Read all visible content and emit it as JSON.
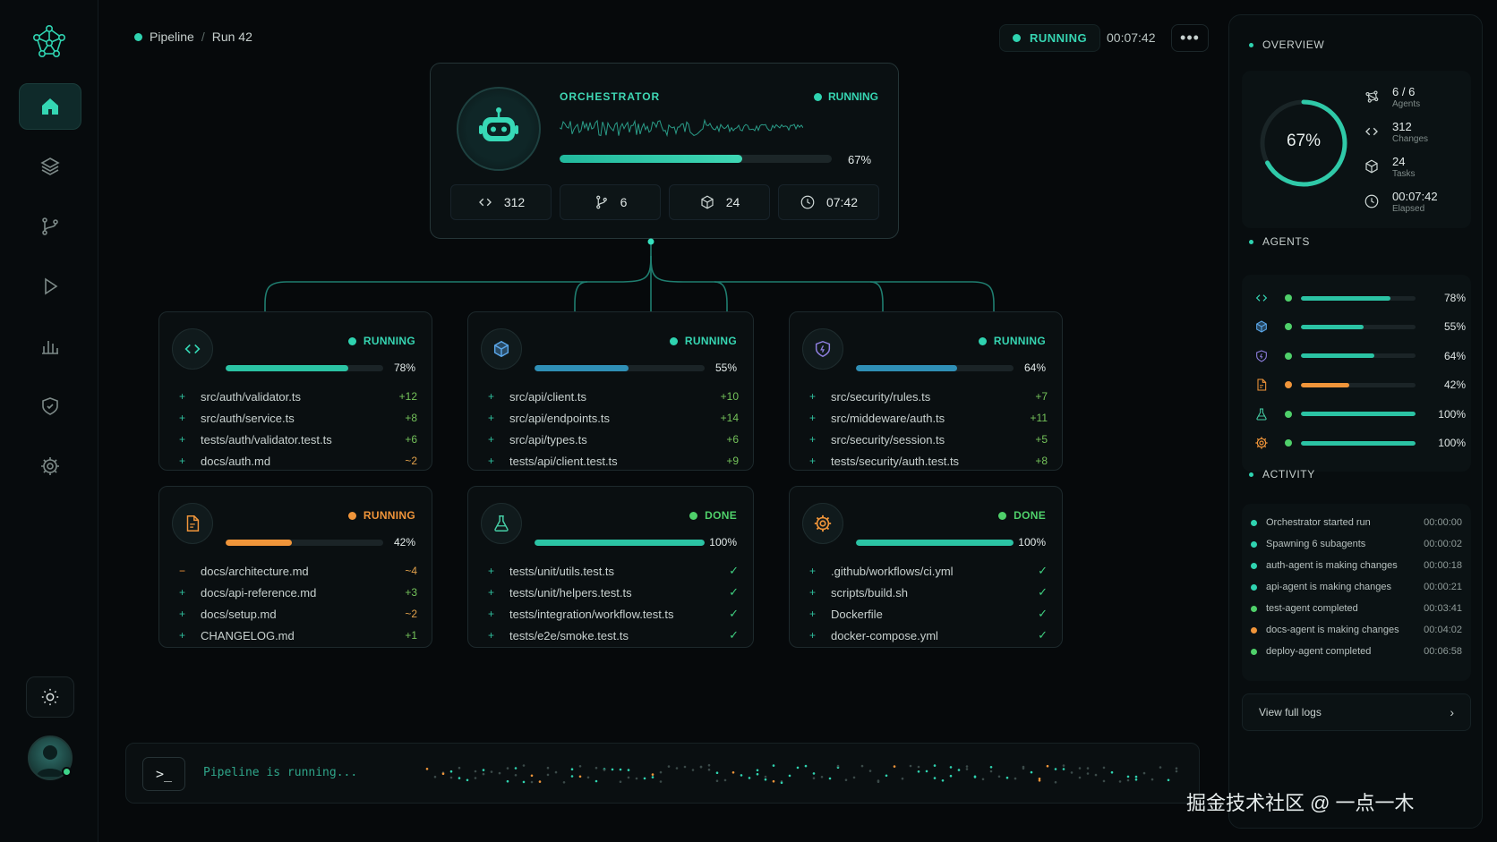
{
  "breadcrumb": {
    "pipeline": "Pipeline",
    "separator": "/",
    "run": "Run 42"
  },
  "top": {
    "status": "RUNNING",
    "elapsed": "00:07:42",
    "more": "•••"
  },
  "orchestrator": {
    "title": "ORCHESTRATOR",
    "status": "RUNNING",
    "progress_pct": 67,
    "progress_label": "67%",
    "stats": {
      "changes": "312",
      "branches": "6",
      "tasks": "24",
      "time": "07:42"
    }
  },
  "cards": [
    {
      "icon": "code-icon",
      "status": "RUNNING",
      "tone": "running",
      "progress_pct": 78,
      "pct_label": "78%",
      "bar_color": "#2bc3a4",
      "files": [
        {
          "mark": "+",
          "name": "src/auth/validator.ts",
          "delta": "+12"
        },
        {
          "mark": "+",
          "name": "src/auth/service.ts",
          "delta": "+8"
        },
        {
          "mark": "+",
          "name": "tests/auth/validator.test.ts",
          "delta": "+6"
        },
        {
          "mark": "+",
          "name": "docs/auth.md",
          "delta": "~2"
        }
      ]
    },
    {
      "icon": "cube-icon",
      "status": "RUNNING",
      "tone": "running",
      "progress_pct": 55,
      "pct_label": "55%",
      "bar_color": "#2f8fb6",
      "files": [
        {
          "mark": "+",
          "name": "src/api/client.ts",
          "delta": "+10"
        },
        {
          "mark": "+",
          "name": "src/api/endpoints.ts",
          "delta": "+14"
        },
        {
          "mark": "+",
          "name": "src/api/types.ts",
          "delta": "+6"
        },
        {
          "mark": "+",
          "name": "tests/api/client.test.ts",
          "delta": "+9"
        }
      ]
    },
    {
      "icon": "shield-icon",
      "status": "RUNNING",
      "tone": "running",
      "progress_pct": 64,
      "pct_label": "64%",
      "bar_color": "#2f8fb6",
      "files": [
        {
          "mark": "+",
          "name": "src/security/rules.ts",
          "delta": "+7"
        },
        {
          "mark": "+",
          "name": "src/middeware/auth.ts",
          "delta": "+11"
        },
        {
          "mark": "+",
          "name": "src/security/session.ts",
          "delta": "+5"
        },
        {
          "mark": "+",
          "name": "tests/security/auth.test.ts",
          "delta": "+8"
        }
      ]
    },
    {
      "icon": "document-icon",
      "status": "RUNNING",
      "tone": "orange",
      "progress_pct": 42,
      "pct_label": "42%",
      "bar_color": "#f0953a",
      "files": [
        {
          "mark": "−",
          "name": "docs/architecture.md",
          "delta": "~4"
        },
        {
          "mark": "+",
          "name": "docs/api-reference.md",
          "delta": "+3"
        },
        {
          "mark": "+",
          "name": "docs/setup.md",
          "delta": "~2"
        },
        {
          "mark": "+",
          "name": "CHANGELOG.md",
          "delta": "+1"
        }
      ]
    },
    {
      "icon": "flask-icon",
      "status": "DONE",
      "tone": "done",
      "progress_pct": 100,
      "pct_label": "100%",
      "bar_color": "#2bc3a4",
      "files": [
        {
          "mark": "+",
          "name": "tests/unit/utils.test.ts",
          "delta": "✓"
        },
        {
          "mark": "+",
          "name": "tests/unit/helpers.test.ts",
          "delta": "✓"
        },
        {
          "mark": "+",
          "name": "tests/integration/workflow.test.ts",
          "delta": "✓"
        },
        {
          "mark": "+",
          "name": "tests/e2e/smoke.test.ts",
          "delta": "✓"
        }
      ]
    },
    {
      "icon": "gear-icon",
      "status": "DONE",
      "tone": "done",
      "progress_pct": 100,
      "pct_label": "100%",
      "bar_color": "#2bc3a4",
      "files": [
        {
          "mark": "+",
          "name": ".github/workflows/ci.yml",
          "delta": "✓"
        },
        {
          "mark": "+",
          "name": "scripts/build.sh",
          "delta": "✓"
        },
        {
          "mark": "+",
          "name": "Dockerfile",
          "delta": "✓"
        },
        {
          "mark": "+",
          "name": "docker-compose.yml",
          "delta": "✓"
        }
      ]
    }
  ],
  "terminal": {
    "prompt": ">_",
    "text": "Pipeline is running..."
  },
  "overview": {
    "title": "OVERVIEW",
    "progress_pct": 67,
    "progress_label": "67%",
    "items": [
      {
        "value": "6 / 6",
        "label": "Agents"
      },
      {
        "value": "312",
        "label": "Changes"
      },
      {
        "value": "24",
        "label": "Tasks"
      },
      {
        "value": "00:07:42",
        "label": "Elapsed"
      }
    ]
  },
  "agents": {
    "title": "AGENTS",
    "rows": [
      {
        "icon": "code-icon",
        "progress_pct": 78,
        "label": "78%",
        "color": "#2bc3a4",
        "dot": "#4fd06a"
      },
      {
        "icon": "cube-icon",
        "progress_pct": 55,
        "label": "55%",
        "color": "#2bc3a4",
        "dot": "#4fd06a"
      },
      {
        "icon": "shield-icon",
        "progress_pct": 64,
        "label": "64%",
        "color": "#2bc3a4",
        "dot": "#4fd06a"
      },
      {
        "icon": "document-icon",
        "progress_pct": 42,
        "label": "42%",
        "color": "#f0953a",
        "dot": "#f0953a"
      },
      {
        "icon": "flask-icon",
        "progress_pct": 100,
        "label": "100%",
        "color": "#2bc3a4",
        "dot": "#4fd06a"
      },
      {
        "icon": "gear-icon",
        "progress_pct": 100,
        "label": "100%",
        "color": "#2bc3a4",
        "dot": "#4fd06a"
      }
    ]
  },
  "activity": {
    "title": "ACTIVITY",
    "rows": [
      {
        "text": "Orchestrator started run",
        "time": "00:00:00",
        "dot": "#2fd3b0"
      },
      {
        "text": "Spawning 6 subagents",
        "time": "00:00:02",
        "dot": "#2fd3b0"
      },
      {
        "text": "auth-agent is making changes",
        "time": "00:00:18",
        "dot": "#2fd3b0"
      },
      {
        "text": "api-agent is making changes",
        "time": "00:00:21",
        "dot": "#2fd3b0"
      },
      {
        "text": "test-agent completed",
        "time": "00:03:41",
        "dot": "#4fd06a"
      },
      {
        "text": "docs-agent is making changes",
        "time": "00:04:02",
        "dot": "#f0953a"
      },
      {
        "text": "deploy-agent completed",
        "time": "00:06:58",
        "dot": "#4fd06a"
      }
    ]
  },
  "logs_button": {
    "label": "View full logs",
    "chevron": "›"
  },
  "watermark": "掘金技术社区 @ 一点一木",
  "colors": {
    "accent": "#36d5b2",
    "orange": "#f0953a",
    "done": "#4fd06a",
    "blue": "#2f8fb6"
  }
}
